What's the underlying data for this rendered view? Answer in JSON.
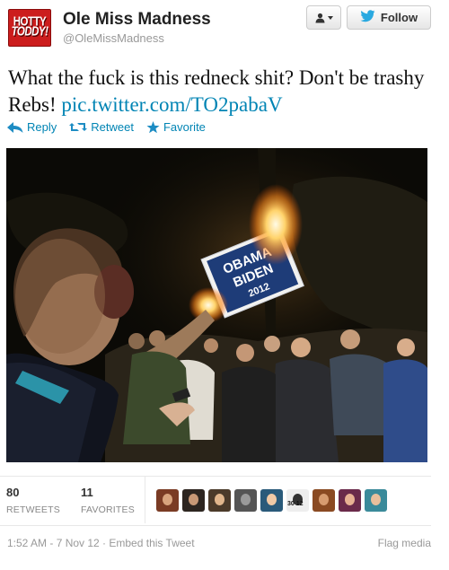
{
  "user": {
    "avatar_line1": "HOTTY",
    "avatar_line2": "TODDY!",
    "name": "Ole Miss Madness",
    "handle": "@OleMissMadness"
  },
  "buttons": {
    "follow_label": "Follow"
  },
  "tweet": {
    "text": "What the fuck is this redneck shit? Don't be trashy Rebs! ",
    "link": "pic.twitter.com/TO2pabaV"
  },
  "actions": {
    "reply": "Reply",
    "retweet": "Retweet",
    "favorite": "Favorite"
  },
  "media": {
    "sign_line1": "OBAMA",
    "sign_line2": "BIDEN",
    "sign_line3": "2012"
  },
  "stats": {
    "retweets_count": "80",
    "retweets_label": "RETWEETS",
    "favorites_count": "11",
    "favorites_label": "FAVORITES"
  },
  "favoriters": [
    {
      "bg": "#7a3b24",
      "face": "#d8a47e"
    },
    {
      "bg": "#2d2520",
      "face": "#c89876"
    },
    {
      "bg": "#4b3a2a",
      "face": "#e0b58c"
    },
    {
      "bg": "#555555",
      "face": "#9a9a9a"
    },
    {
      "bg": "#2a5a7a",
      "face": "#f0c9a6"
    },
    {
      "bg": "#eeeeee",
      "face": "#333333"
    },
    {
      "bg": "#8a4a22",
      "face": "#d79c70"
    },
    {
      "bg": "#6a2a4a",
      "face": "#e7b193"
    },
    {
      "bg": "#3a8a9a",
      "face": "#e9bf9c"
    }
  ],
  "favoriter_jersey_text": "30  12",
  "footer": {
    "timestamp": "1:52 AM - 7 Nov 12 · Embed this Tweet",
    "flag": "Flag media"
  },
  "colors": {
    "link": "#0084b4",
    "avatar_red": "#cc1d1d",
    "follow_bird": "#2aa9e0"
  }
}
